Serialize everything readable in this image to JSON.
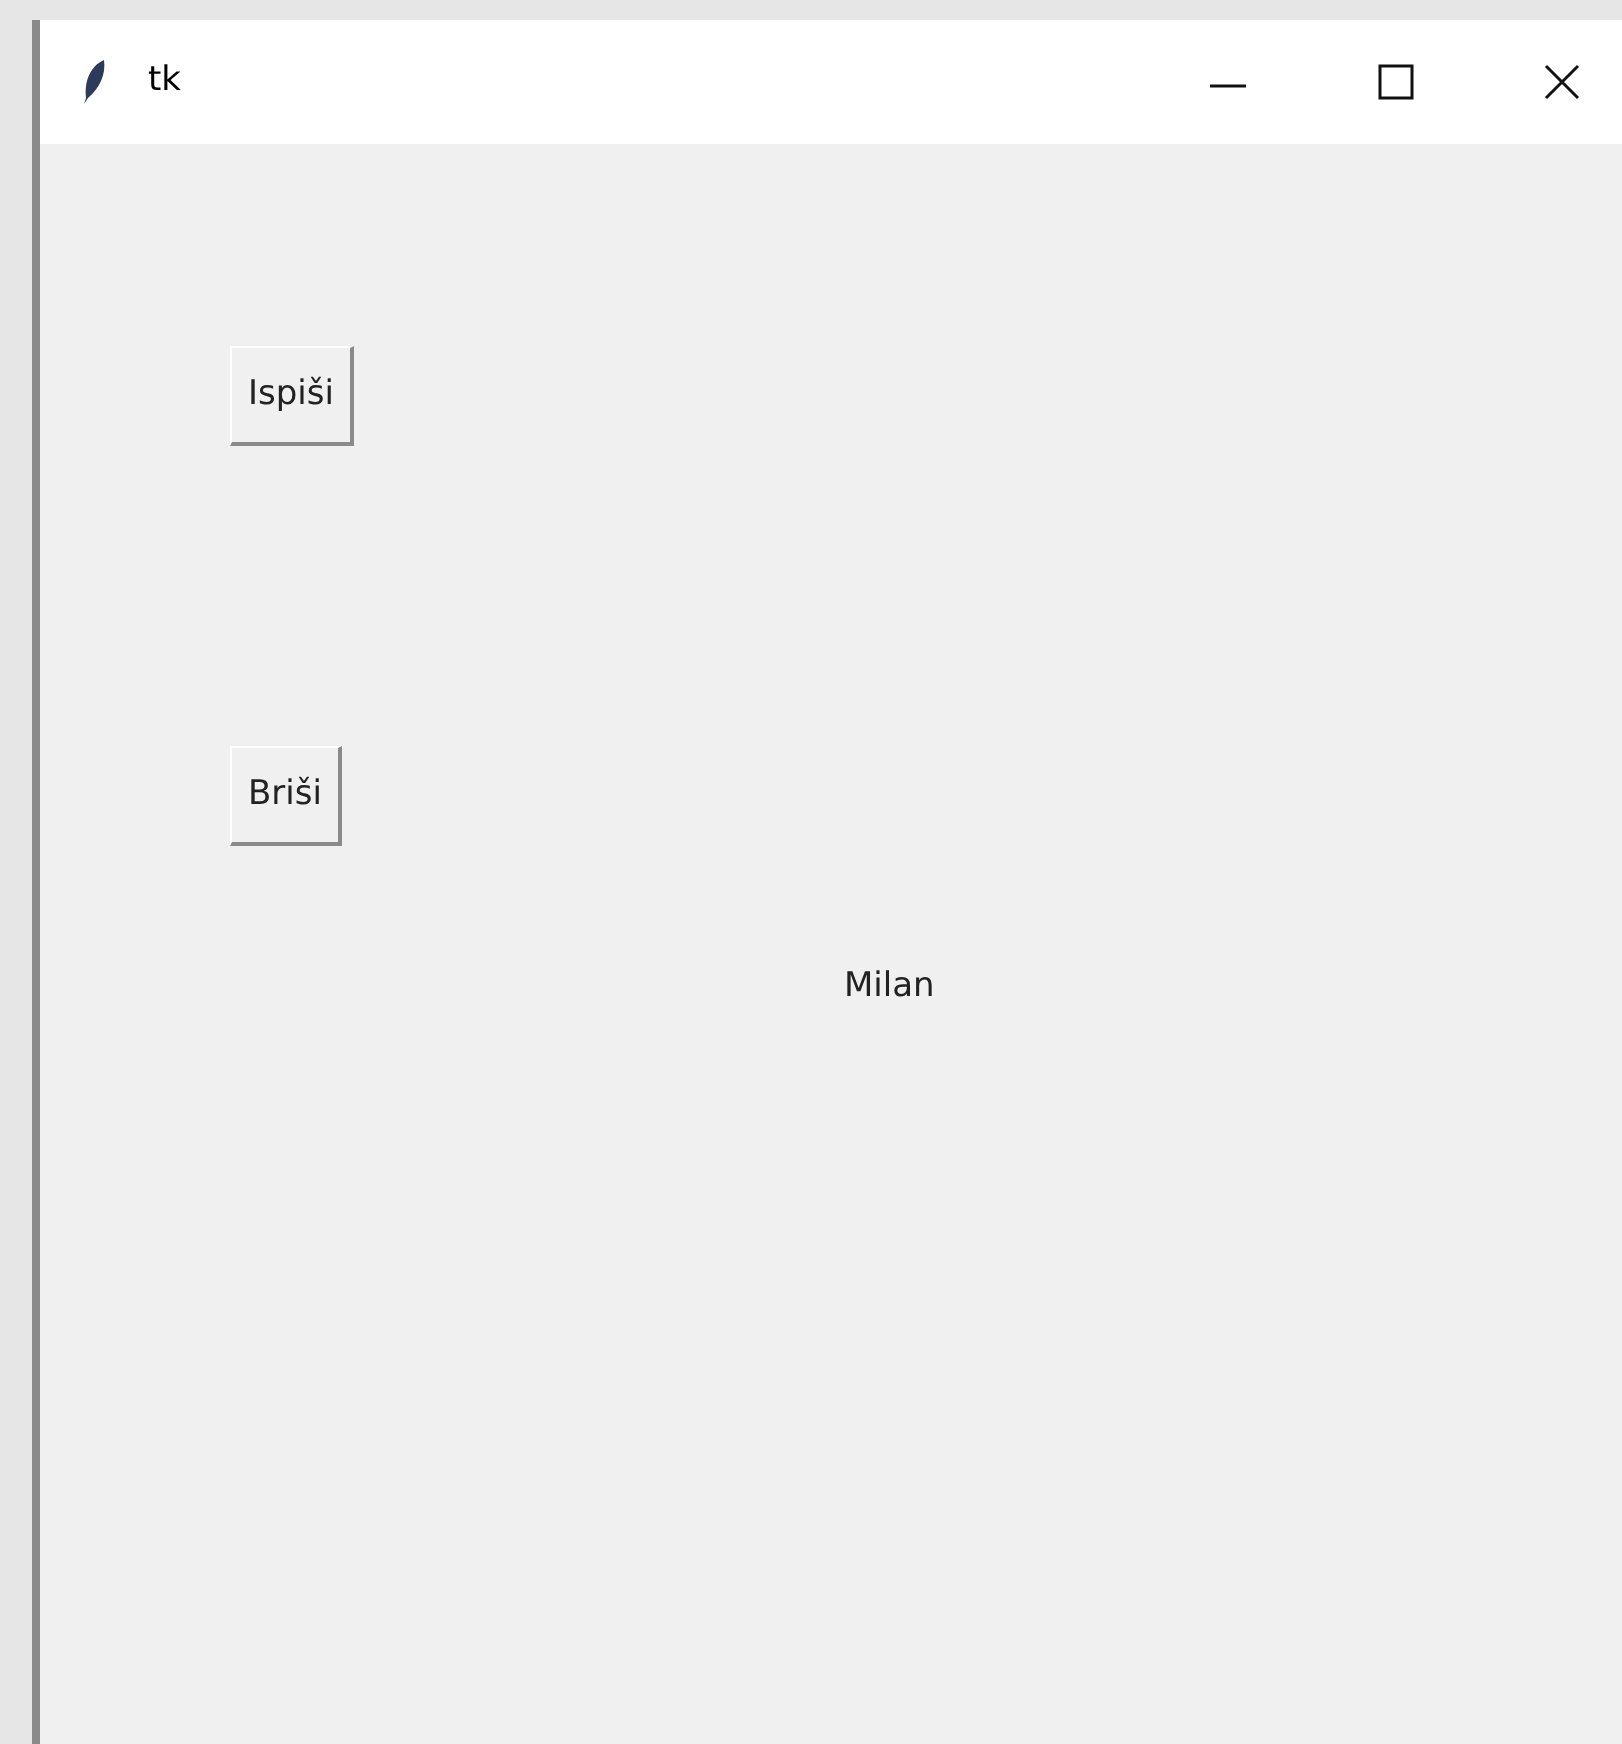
{
  "window": {
    "title": "tk"
  },
  "buttons": [
    {
      "label": "Ispiši"
    },
    {
      "label": "Briši"
    }
  ],
  "label": "Milan"
}
